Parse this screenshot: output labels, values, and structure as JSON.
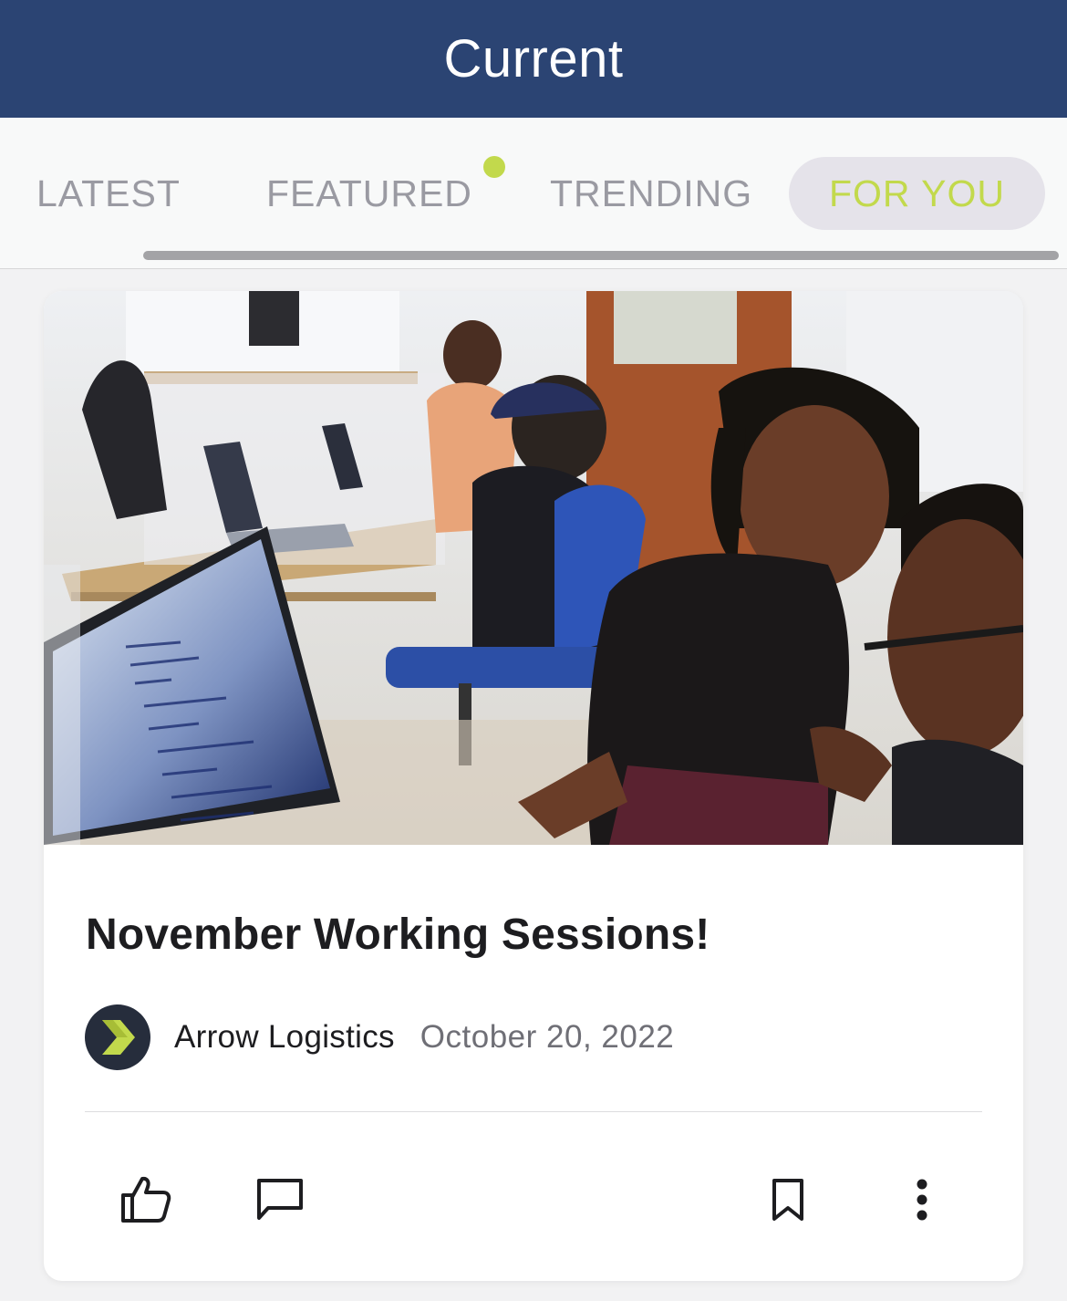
{
  "header": {
    "title": "Current"
  },
  "tabs": [
    {
      "label": "LATEST",
      "active": false
    },
    {
      "label": "FEATURED",
      "active": false,
      "has_dot": true
    },
    {
      "label": "TRENDING",
      "active": false
    },
    {
      "label": "FOR YOU",
      "active": true
    }
  ],
  "colors": {
    "header_bg": "#2b4473",
    "accent": "#c2d94c",
    "tab_inactive": "#9a9aa2",
    "tab_active_bg": "#e5e3ea"
  },
  "post": {
    "image_alt": "Office photo",
    "title": "November Working Sessions!",
    "author": "Arrow Logistics",
    "date": "October 20, 2022"
  },
  "actions": [
    {
      "icon": "thumbs-up-icon"
    },
    {
      "icon": "comment-icon"
    },
    {
      "icon": "bookmark-icon"
    },
    {
      "icon": "more-vertical-icon"
    }
  ]
}
